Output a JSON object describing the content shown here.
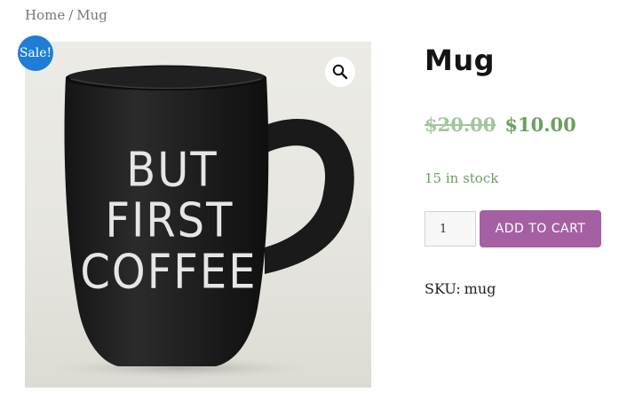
{
  "breadcrumb": {
    "home": "Home",
    "separator": "/",
    "current": "Mug"
  },
  "gallery": {
    "sale_badge": "Sale!",
    "zoom_icon": "magnifier-icon",
    "mug_print_lines": [
      "BUT",
      "FIRST",
      "COFFEE"
    ]
  },
  "product": {
    "title": "Mug",
    "regular_price": "$20.00",
    "sale_price": "$10.00",
    "stock": "15 in stock",
    "quantity": "1",
    "add_to_cart_label": "ADD TO CART",
    "sku_label": "SKU:",
    "sku_value": "mug"
  },
  "colors": {
    "sale_badge": "#1e7ed6",
    "add_to_cart": "#a560a3",
    "price_green": "#6ba05f",
    "old_price": "#a3c59b"
  }
}
